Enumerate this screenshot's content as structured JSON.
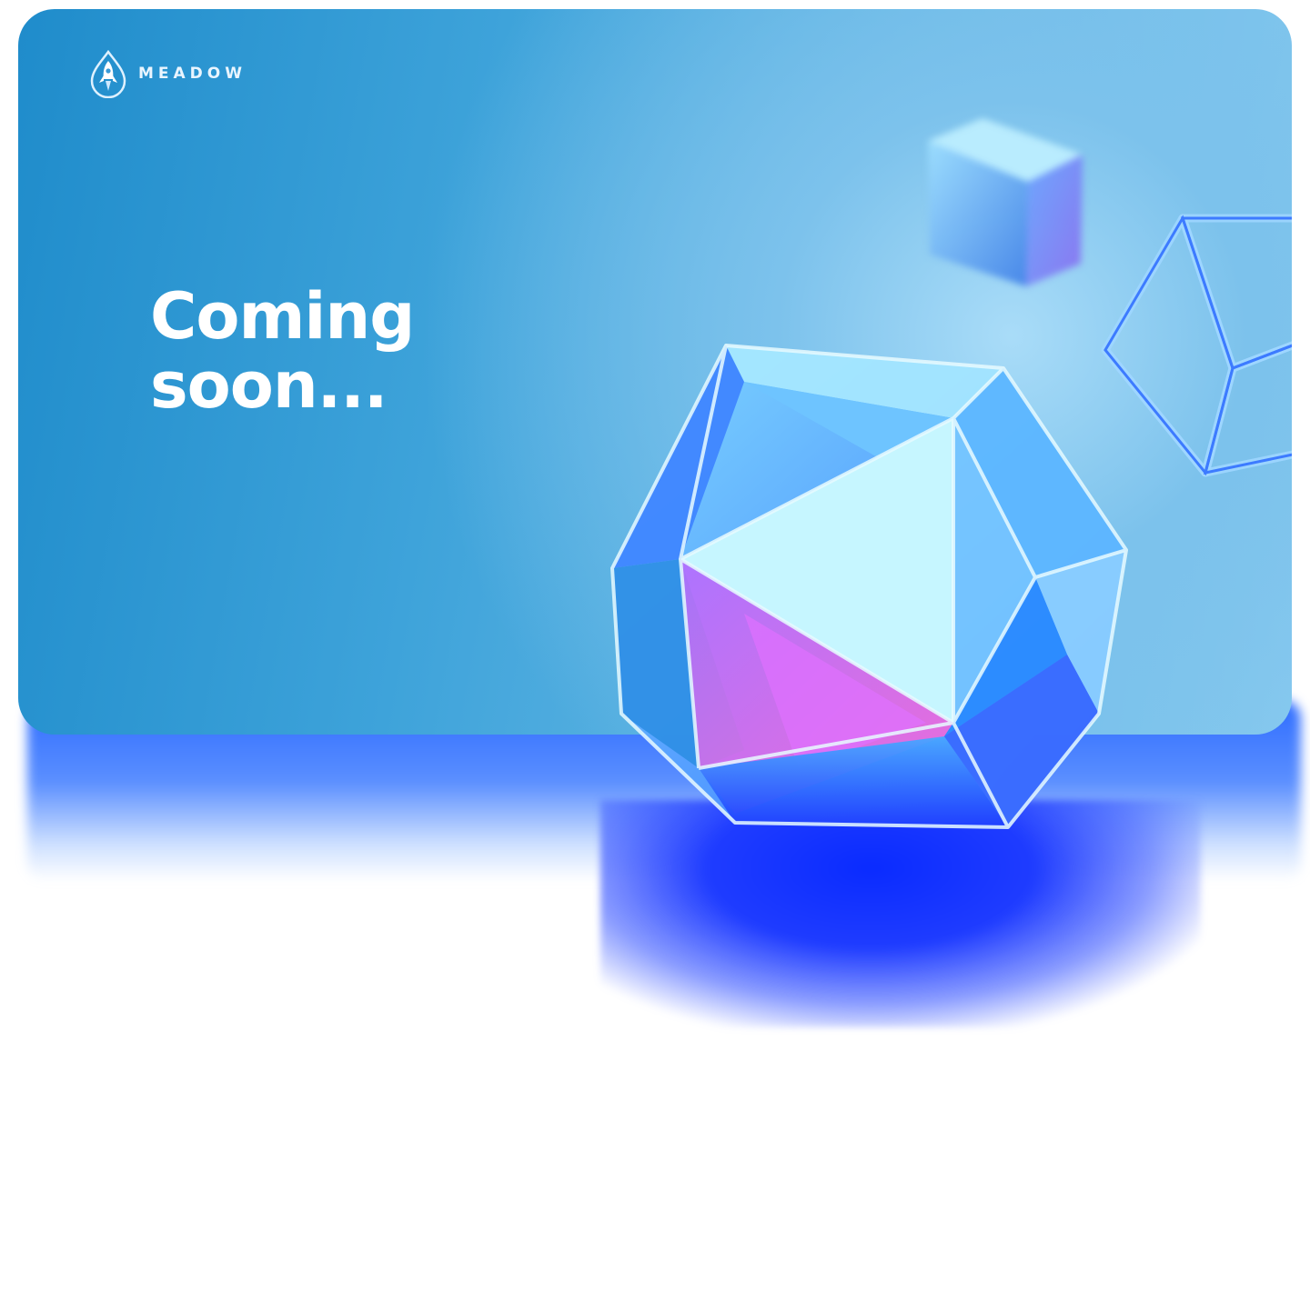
{
  "brand": {
    "name": "MEADOW",
    "logo_icon": "rocket-drop-icon"
  },
  "hero": {
    "headline_line1": "Coming",
    "headline_line2": "soon..."
  },
  "illustrations": {
    "main": "crystal-icosahedron-icon",
    "secondary": "blurred-glass-cube-icon",
    "tertiary": "wireframe-cube-icon"
  },
  "colors": {
    "card_start": "#1f8ccb",
    "card_end": "#8acbef",
    "glow": "#1f3cff",
    "text": "#ffffff"
  }
}
